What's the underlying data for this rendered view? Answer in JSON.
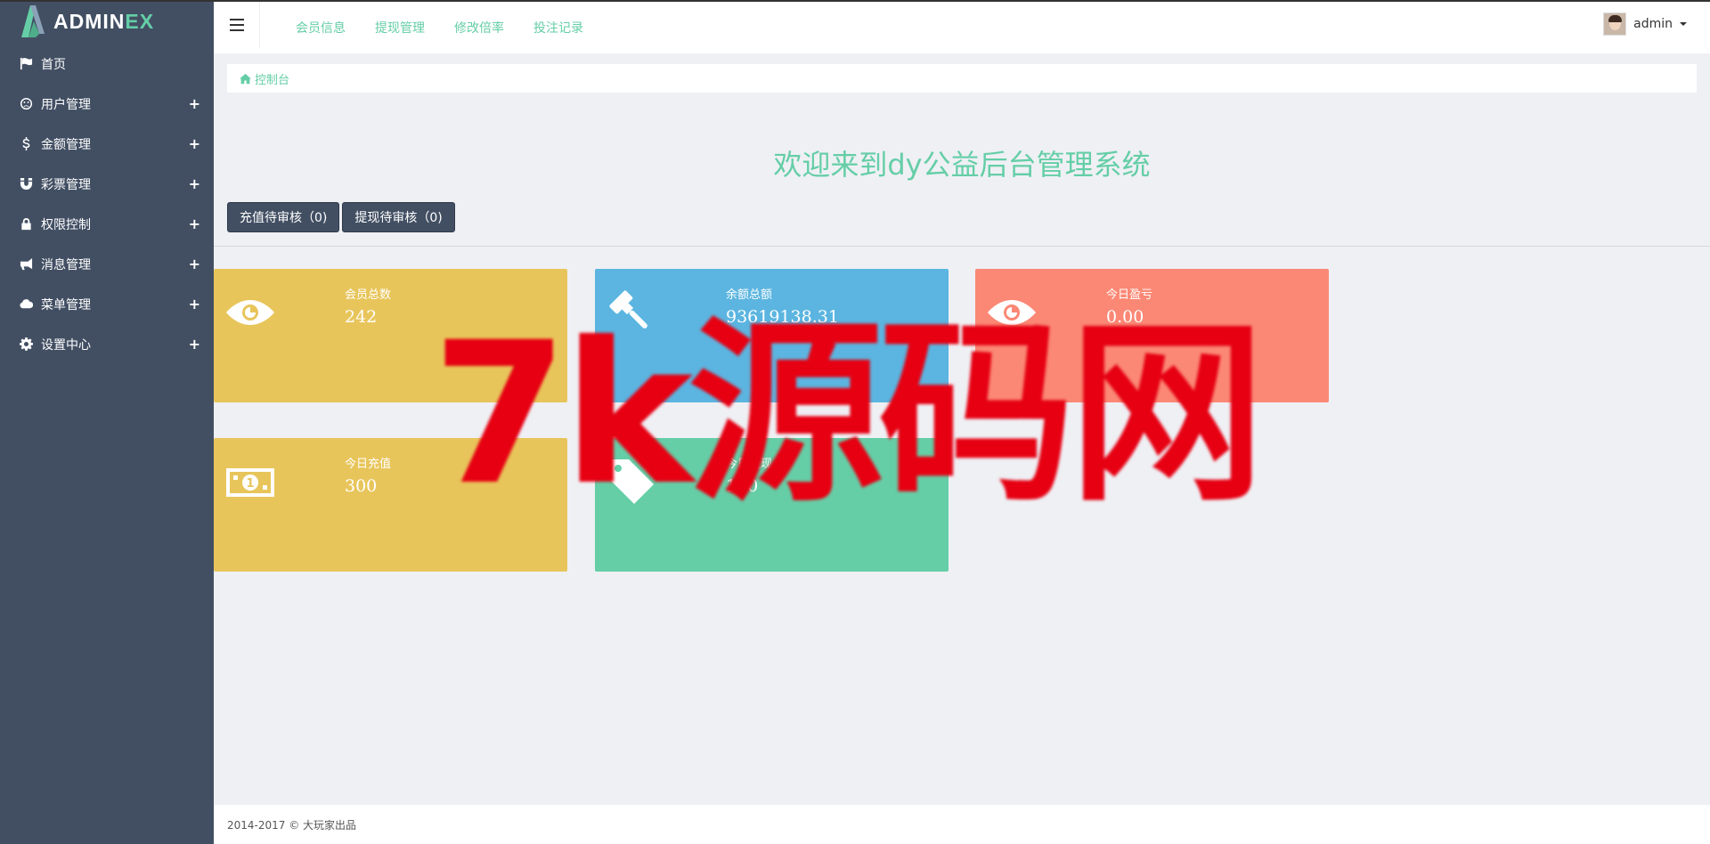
{
  "brand": {
    "logo_main": "ADMIN",
    "logo_accent": "EX"
  },
  "sidebar": {
    "items": [
      {
        "label": "首页",
        "icon": "flag-icon",
        "expandable": false
      },
      {
        "label": "用户管理",
        "icon": "frown-icon",
        "expandable": true
      },
      {
        "label": "金额管理",
        "icon": "dollar-icon",
        "expandable": true
      },
      {
        "label": "彩票管理",
        "icon": "magnet-icon",
        "expandable": true
      },
      {
        "label": "权限控制",
        "icon": "lock-icon",
        "expandable": true
      },
      {
        "label": "消息管理",
        "icon": "bullhorn-icon",
        "expandable": true
      },
      {
        "label": "菜单管理",
        "icon": "cloud-icon",
        "expandable": true
      },
      {
        "label": "设置中心",
        "icon": "gear-icon",
        "expandable": true
      }
    ],
    "plus": "+"
  },
  "header": {
    "nav": [
      "会员信息",
      "提现管理",
      "修改倍率",
      "投注记录"
    ],
    "user": "admin"
  },
  "breadcrumb": {
    "label": "控制台"
  },
  "main": {
    "welcome": "欢迎来到dy公益后台管理系统",
    "buttons": [
      "充值待审核（0)",
      "提现待审核（0)"
    ],
    "cards": [
      {
        "label": "会员总数",
        "value": "242",
        "icon": "eye-icon",
        "color": "#e8c55b"
      },
      {
        "label": "余额总额",
        "value": "93619138.31",
        "icon": "gavel-icon",
        "color": "#5bb5e0"
      },
      {
        "label": "今日盈亏",
        "value": "0.00",
        "icon": "eye-icon",
        "color": "#fb8875"
      },
      {
        "label": "今日充值",
        "value": "300",
        "icon": "money-icon",
        "color": "#e8c55b"
      },
      {
        "label": "今日提现",
        "value": "100",
        "icon": "tag-icon",
        "color": "#65cea7"
      }
    ]
  },
  "footer": {
    "text": "2014-2017 © 大玩家出品"
  },
  "watermark": {
    "text": "7k源码网",
    "color": "#e60012"
  },
  "colors": {
    "sidebar": "#424f63",
    "accent": "#65cea7",
    "background": "#eff0f4"
  }
}
